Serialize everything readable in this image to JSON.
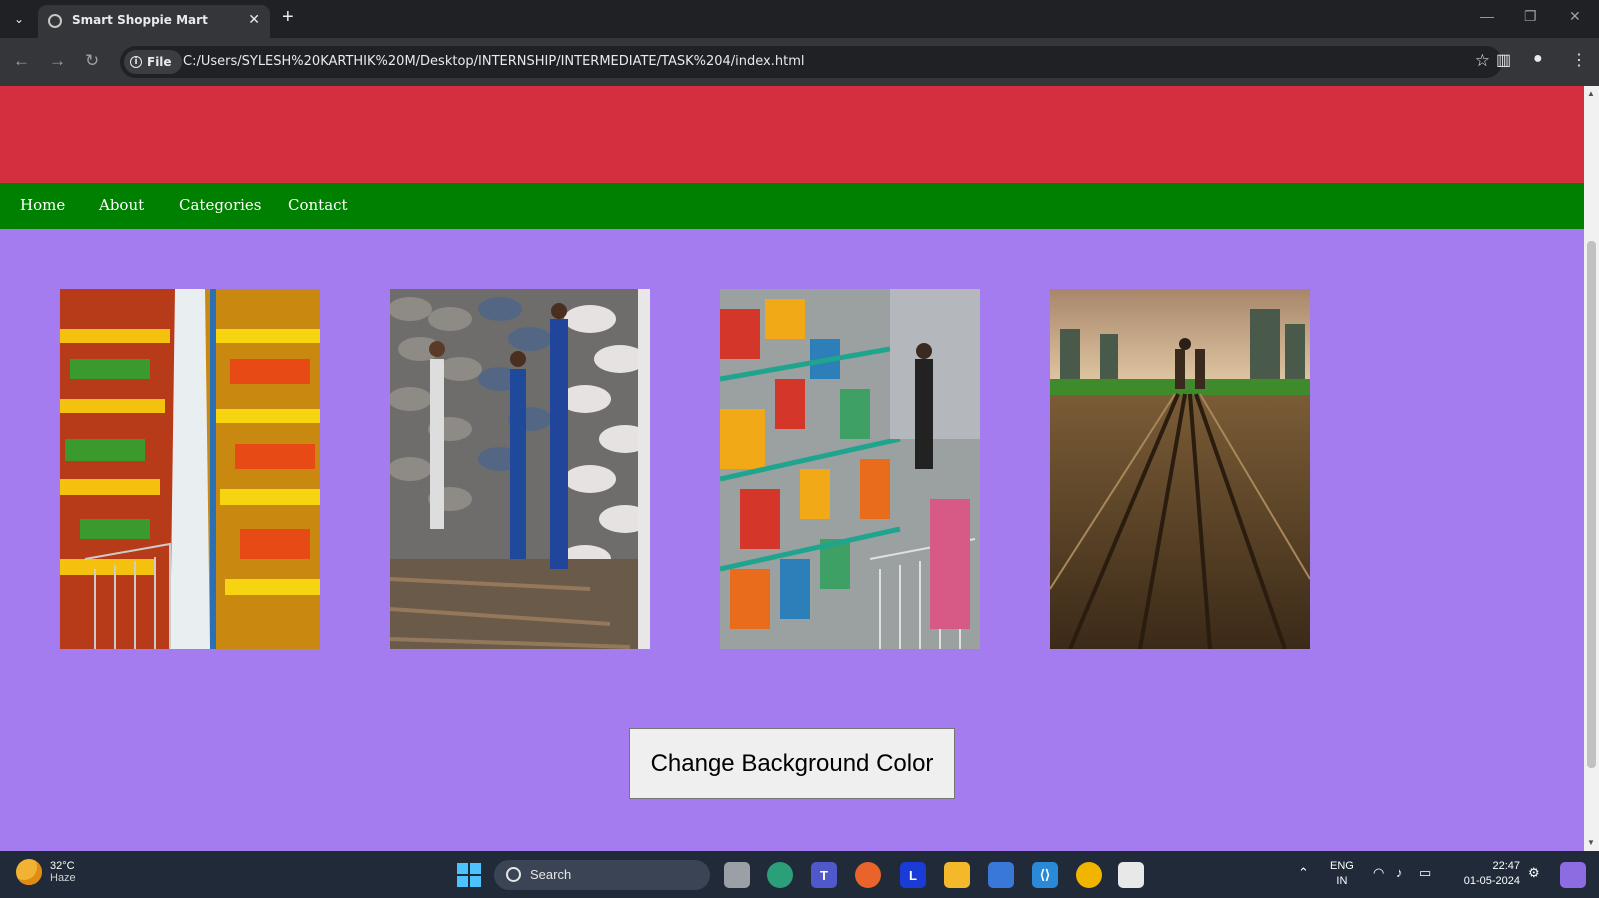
{
  "browser": {
    "tab_title": "Smart Shoppie Mart",
    "url_chip": "File",
    "url": "C:/Users/SYLESH%20KARTHIK%20M/Desktop/INTERNSHIP/INTERMEDIATE/TASK%204/index.html"
  },
  "site": {
    "nav": [
      "Home",
      "About",
      "Categories",
      "Contact"
    ],
    "images": [
      "supermarket-aisle-image",
      "warehouse-sacks-image",
      "grocery-shelves-image",
      "farm-field-image"
    ],
    "button_label": "Change Background Color",
    "colors": {
      "header": "#d32f3e",
      "nav": "#008000",
      "content": "#a57cf0"
    }
  },
  "taskbar": {
    "weather_temp": "32°C",
    "weather_desc": "Haze",
    "search_label": "Search",
    "lang_line1": "ENG",
    "lang_line2": "IN",
    "time": "22:47",
    "date": "01-05-2024"
  }
}
